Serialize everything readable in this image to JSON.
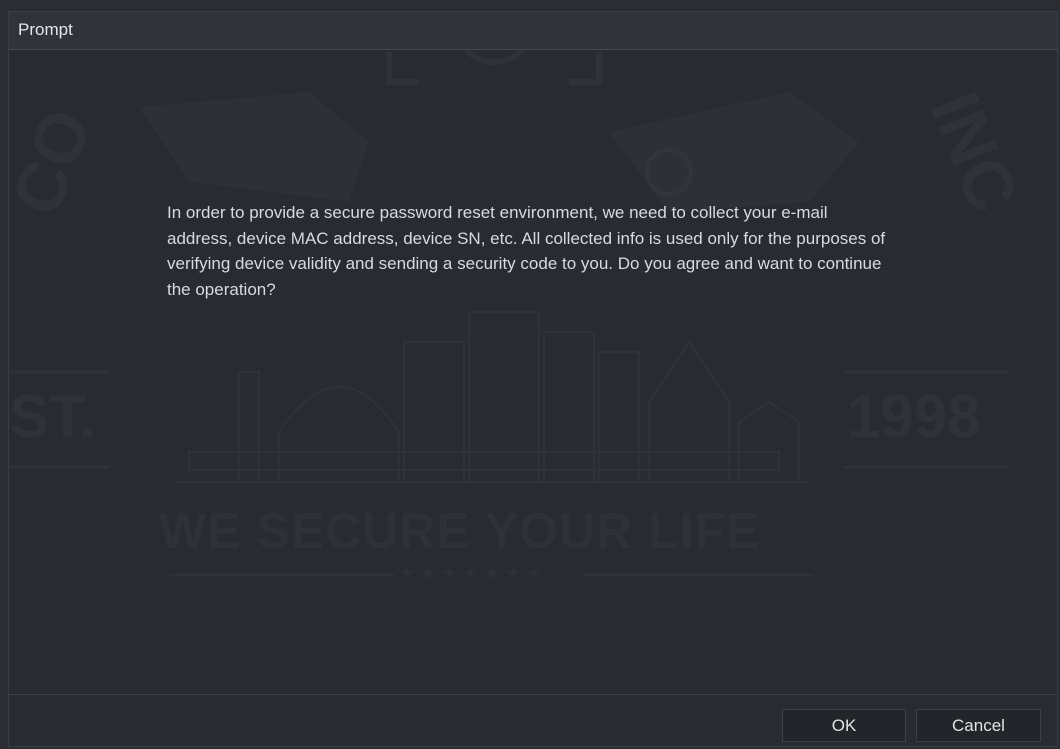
{
  "dialog": {
    "title": "Prompt",
    "message": "In order to provide a secure password reset environment, we need to collect your e-mail address, device MAC address, device SN, etc. All collected info is used only for the purposes of verifying device validity and sending a security code to you. Do you agree and want to continue the operation?"
  },
  "watermark": {
    "slogan": "WE SECURE YOUR LIFE",
    "est": "ST.",
    "year": "1998",
    "letters_right": "INC",
    "letters_left": "CO",
    "stars": "★ ★ ★ ★ ★ ★ ★"
  },
  "buttons": {
    "ok_label": "OK",
    "cancel_label": "Cancel"
  },
  "colors": {
    "background": "#282b31",
    "titlebar": "#30333a",
    "text": "#d8dadf",
    "watermark": "#2f3238"
  }
}
